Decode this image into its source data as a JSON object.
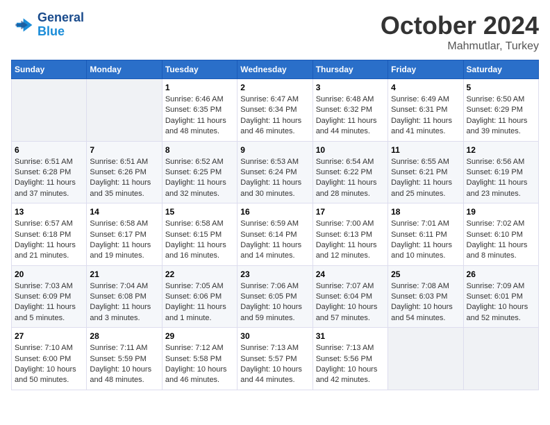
{
  "header": {
    "logo_line1": "General",
    "logo_line2": "Blue",
    "month": "October 2024",
    "location": "Mahmutlar, Turkey"
  },
  "weekdays": [
    "Sunday",
    "Monday",
    "Tuesday",
    "Wednesday",
    "Thursday",
    "Friday",
    "Saturday"
  ],
  "weeks": [
    [
      {
        "day": "",
        "text": ""
      },
      {
        "day": "",
        "text": ""
      },
      {
        "day": "1",
        "text": "Sunrise: 6:46 AM\nSunset: 6:35 PM\nDaylight: 11 hours and 48 minutes."
      },
      {
        "day": "2",
        "text": "Sunrise: 6:47 AM\nSunset: 6:34 PM\nDaylight: 11 hours and 46 minutes."
      },
      {
        "day": "3",
        "text": "Sunrise: 6:48 AM\nSunset: 6:32 PM\nDaylight: 11 hours and 44 minutes."
      },
      {
        "day": "4",
        "text": "Sunrise: 6:49 AM\nSunset: 6:31 PM\nDaylight: 11 hours and 41 minutes."
      },
      {
        "day": "5",
        "text": "Sunrise: 6:50 AM\nSunset: 6:29 PM\nDaylight: 11 hours and 39 minutes."
      }
    ],
    [
      {
        "day": "6",
        "text": "Sunrise: 6:51 AM\nSunset: 6:28 PM\nDaylight: 11 hours and 37 minutes."
      },
      {
        "day": "7",
        "text": "Sunrise: 6:51 AM\nSunset: 6:26 PM\nDaylight: 11 hours and 35 minutes."
      },
      {
        "day": "8",
        "text": "Sunrise: 6:52 AM\nSunset: 6:25 PM\nDaylight: 11 hours and 32 minutes."
      },
      {
        "day": "9",
        "text": "Sunrise: 6:53 AM\nSunset: 6:24 PM\nDaylight: 11 hours and 30 minutes."
      },
      {
        "day": "10",
        "text": "Sunrise: 6:54 AM\nSunset: 6:22 PM\nDaylight: 11 hours and 28 minutes."
      },
      {
        "day": "11",
        "text": "Sunrise: 6:55 AM\nSunset: 6:21 PM\nDaylight: 11 hours and 25 minutes."
      },
      {
        "day": "12",
        "text": "Sunrise: 6:56 AM\nSunset: 6:19 PM\nDaylight: 11 hours and 23 minutes."
      }
    ],
    [
      {
        "day": "13",
        "text": "Sunrise: 6:57 AM\nSunset: 6:18 PM\nDaylight: 11 hours and 21 minutes."
      },
      {
        "day": "14",
        "text": "Sunrise: 6:58 AM\nSunset: 6:17 PM\nDaylight: 11 hours and 19 minutes."
      },
      {
        "day": "15",
        "text": "Sunrise: 6:58 AM\nSunset: 6:15 PM\nDaylight: 11 hours and 16 minutes."
      },
      {
        "day": "16",
        "text": "Sunrise: 6:59 AM\nSunset: 6:14 PM\nDaylight: 11 hours and 14 minutes."
      },
      {
        "day": "17",
        "text": "Sunrise: 7:00 AM\nSunset: 6:13 PM\nDaylight: 11 hours and 12 minutes."
      },
      {
        "day": "18",
        "text": "Sunrise: 7:01 AM\nSunset: 6:11 PM\nDaylight: 11 hours and 10 minutes."
      },
      {
        "day": "19",
        "text": "Sunrise: 7:02 AM\nSunset: 6:10 PM\nDaylight: 11 hours and 8 minutes."
      }
    ],
    [
      {
        "day": "20",
        "text": "Sunrise: 7:03 AM\nSunset: 6:09 PM\nDaylight: 11 hours and 5 minutes."
      },
      {
        "day": "21",
        "text": "Sunrise: 7:04 AM\nSunset: 6:08 PM\nDaylight: 11 hours and 3 minutes."
      },
      {
        "day": "22",
        "text": "Sunrise: 7:05 AM\nSunset: 6:06 PM\nDaylight: 11 hours and 1 minute."
      },
      {
        "day": "23",
        "text": "Sunrise: 7:06 AM\nSunset: 6:05 PM\nDaylight: 10 hours and 59 minutes."
      },
      {
        "day": "24",
        "text": "Sunrise: 7:07 AM\nSunset: 6:04 PM\nDaylight: 10 hours and 57 minutes."
      },
      {
        "day": "25",
        "text": "Sunrise: 7:08 AM\nSunset: 6:03 PM\nDaylight: 10 hours and 54 minutes."
      },
      {
        "day": "26",
        "text": "Sunrise: 7:09 AM\nSunset: 6:01 PM\nDaylight: 10 hours and 52 minutes."
      }
    ],
    [
      {
        "day": "27",
        "text": "Sunrise: 7:10 AM\nSunset: 6:00 PM\nDaylight: 10 hours and 50 minutes."
      },
      {
        "day": "28",
        "text": "Sunrise: 7:11 AM\nSunset: 5:59 PM\nDaylight: 10 hours and 48 minutes."
      },
      {
        "day": "29",
        "text": "Sunrise: 7:12 AM\nSunset: 5:58 PM\nDaylight: 10 hours and 46 minutes."
      },
      {
        "day": "30",
        "text": "Sunrise: 7:13 AM\nSunset: 5:57 PM\nDaylight: 10 hours and 44 minutes."
      },
      {
        "day": "31",
        "text": "Sunrise: 7:13 AM\nSunset: 5:56 PM\nDaylight: 10 hours and 42 minutes."
      },
      {
        "day": "",
        "text": ""
      },
      {
        "day": "",
        "text": ""
      }
    ]
  ]
}
